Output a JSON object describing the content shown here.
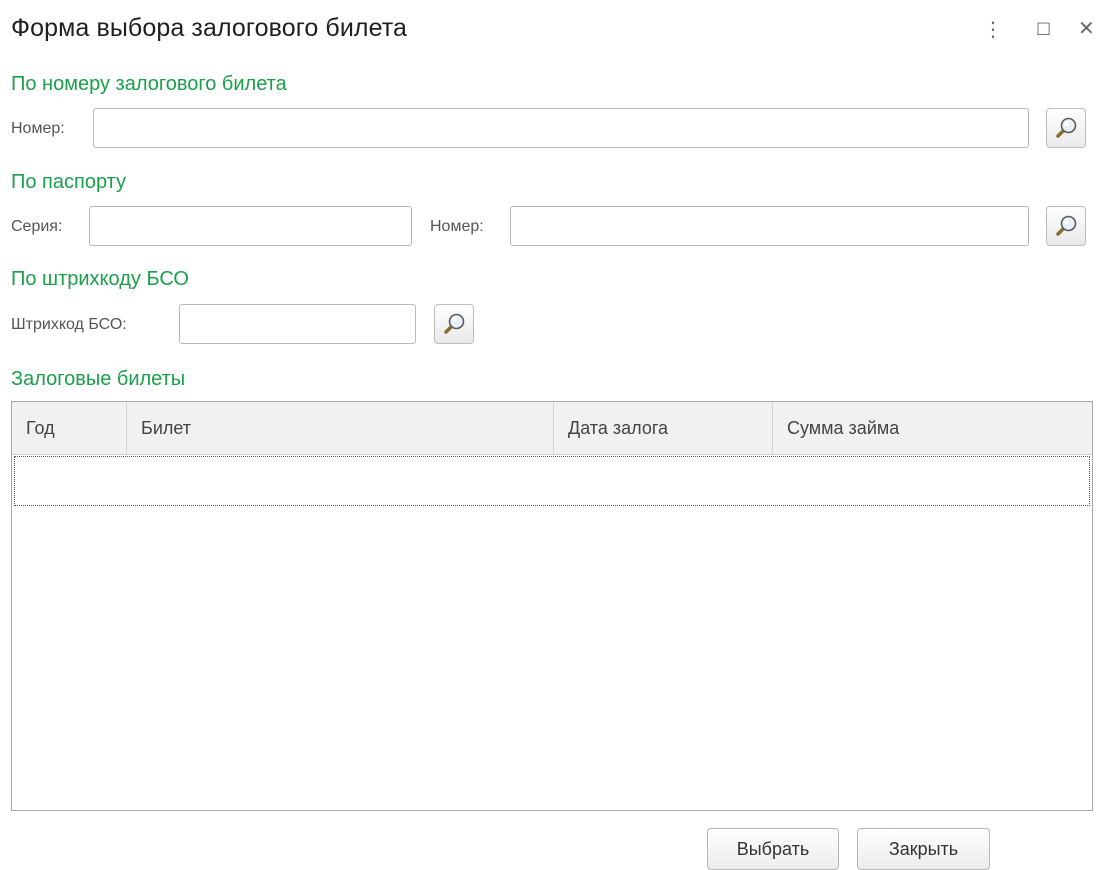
{
  "window": {
    "title": "Форма выбора залогового билета",
    "controls": {
      "more": "⋮",
      "maximize": "☐",
      "close": "✕"
    }
  },
  "by_ticket": {
    "heading": "По номеру залогового билета",
    "number_label": "Номер:",
    "number_value": ""
  },
  "by_passport": {
    "heading": "По паспорту",
    "series_label": "Серия:",
    "series_value": "",
    "number_label": "Номер:",
    "number_value": ""
  },
  "by_barcode": {
    "heading": "По штрихкоду БСО",
    "barcode_label": "Штрихкод БСО:",
    "barcode_value": ""
  },
  "tickets": {
    "heading": "Залоговые билеты",
    "columns": [
      "Год",
      "Билет",
      "Дата залога",
      "Сумма займа"
    ]
  },
  "footer": {
    "select_label": "Выбрать",
    "close_label": "Закрыть"
  },
  "colors": {
    "section_heading": "#1aa04b",
    "border": "#b9b9b9",
    "grid_header_bg": "#f1f1f1"
  },
  "icons": {
    "search": "magnifier-icon"
  }
}
